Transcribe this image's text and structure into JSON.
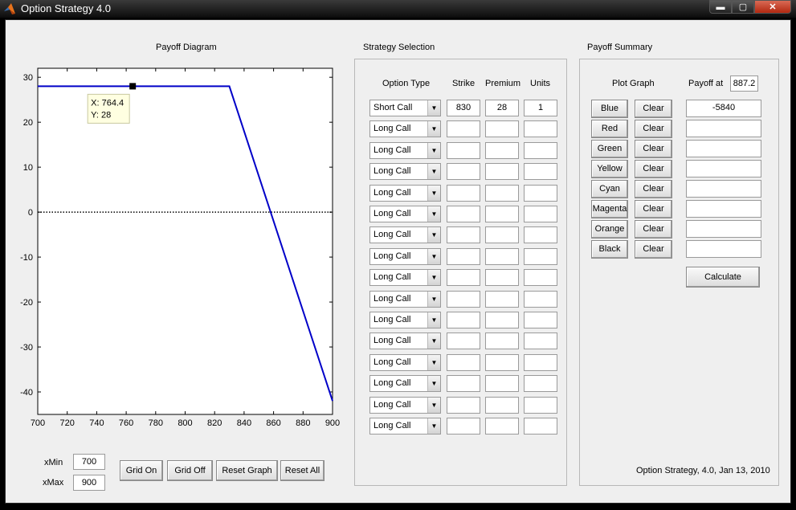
{
  "window": {
    "title": "Option Strategy 4.0",
    "min_glyph": "▬",
    "max_glyph": "▢",
    "close_glyph": "✕"
  },
  "plot": {
    "title": "Payoff Diagram",
    "datatip": {
      "x": "X: 764.4",
      "y": "Y: 28"
    }
  },
  "chart_data": {
    "type": "line",
    "title": "Payoff Diagram",
    "xlabel": "",
    "ylabel": "",
    "xlim": [
      700,
      900
    ],
    "ylim": [
      -45,
      32
    ],
    "xticks": [
      700,
      720,
      740,
      760,
      780,
      800,
      820,
      840,
      860,
      880,
      900
    ],
    "yticks": [
      30,
      20,
      10,
      0,
      -10,
      -20,
      -30,
      -40
    ],
    "grid": false,
    "series": [
      {
        "color": "#0000c8",
        "x": [
          700,
          830,
          900
        ],
        "y": [
          28,
          28,
          -42
        ]
      }
    ],
    "zero_line": {
      "y": 0,
      "style": "dotted"
    },
    "datatip": {
      "x": 764.4,
      "y": 28
    }
  },
  "axis_controls": {
    "xmin_label": "xMin",
    "xmin_value": "700",
    "xmax_label": "xMax",
    "xmax_value": "900",
    "buttons": [
      "Grid On",
      "Grid Off",
      "Reset Graph",
      "Reset All"
    ]
  },
  "strategy": {
    "title": "Strategy Selection",
    "headers": [
      "Option Type",
      "Strike",
      "Premium",
      "Units"
    ],
    "rows": [
      {
        "type": "Short Call",
        "strike": "830",
        "premium": "28",
        "units": "1"
      },
      {
        "type": "Long Call",
        "strike": "",
        "premium": "",
        "units": ""
      },
      {
        "type": "Long Call",
        "strike": "",
        "premium": "",
        "units": ""
      },
      {
        "type": "Long Call",
        "strike": "",
        "premium": "",
        "units": ""
      },
      {
        "type": "Long Call",
        "strike": "",
        "premium": "",
        "units": ""
      },
      {
        "type": "Long Call",
        "strike": "",
        "premium": "",
        "units": ""
      },
      {
        "type": "Long Call",
        "strike": "",
        "premium": "",
        "units": ""
      },
      {
        "type": "Long Call",
        "strike": "",
        "premium": "",
        "units": ""
      },
      {
        "type": "Long Call",
        "strike": "",
        "premium": "",
        "units": ""
      },
      {
        "type": "Long Call",
        "strike": "",
        "premium": "",
        "units": ""
      },
      {
        "type": "Long Call",
        "strike": "",
        "premium": "",
        "units": ""
      },
      {
        "type": "Long Call",
        "strike": "",
        "premium": "",
        "units": ""
      },
      {
        "type": "Long Call",
        "strike": "",
        "premium": "",
        "units": ""
      },
      {
        "type": "Long Call",
        "strike": "",
        "premium": "",
        "units": ""
      },
      {
        "type": "Long Call",
        "strike": "",
        "premium": "",
        "units": ""
      },
      {
        "type": "Long Call",
        "strike": "",
        "premium": "",
        "units": ""
      }
    ]
  },
  "summary": {
    "title": "Payoff Summary",
    "plot_graph_label": "Plot Graph",
    "payoff_at_label": "Payoff at",
    "payoff_at_value": "887.2",
    "rows": [
      {
        "color": "Blue",
        "clear": "Clear",
        "value": "-5840"
      },
      {
        "color": "Red",
        "clear": "Clear",
        "value": ""
      },
      {
        "color": "Green",
        "clear": "Clear",
        "value": ""
      },
      {
        "color": "Yellow",
        "clear": "Clear",
        "value": ""
      },
      {
        "color": "Cyan",
        "clear": "Clear",
        "value": ""
      },
      {
        "color": "Magenta",
        "clear": "Clear",
        "value": ""
      },
      {
        "color": "Orange",
        "clear": "Clear",
        "value": ""
      },
      {
        "color": "Black",
        "clear": "Clear",
        "value": ""
      }
    ],
    "calculate_label": "Calculate",
    "footer": "Option Strategy, 4.0, Jan 13, 2010"
  }
}
